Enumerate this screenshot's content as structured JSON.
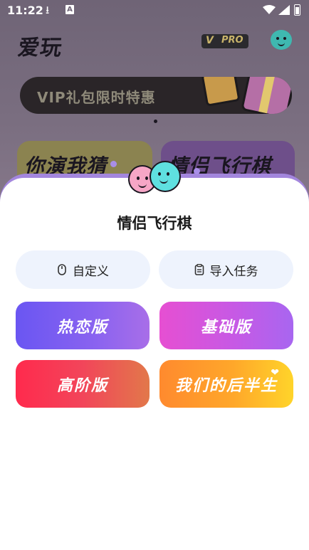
{
  "status_bar": {
    "time": "11:22",
    "download_icon": "download-icon",
    "notification_letter": "A",
    "wifi_icon": "wifi-icon",
    "signal_icon": "signal-icon",
    "battery_icon": "battery-icon"
  },
  "header": {
    "app_title": "爱玩",
    "pro_badge_mark": "V",
    "pro_badge_text": "PRO"
  },
  "banner": {
    "text": "VIP礼包限时特惠"
  },
  "game_cards": [
    {
      "title": "你演我猜"
    },
    {
      "title": "情侣飞行棋"
    }
  ],
  "sheet": {
    "title": "情侣飞行棋",
    "actions": [
      {
        "label": "自定义",
        "icon": "mouse-icon"
      },
      {
        "label": "导入任务",
        "icon": "clipboard-icon"
      }
    ],
    "modes": [
      {
        "label": "热恋版"
      },
      {
        "label": "基础版"
      },
      {
        "label": "高阶版"
      },
      {
        "label": "我们的后半生"
      }
    ]
  },
  "colors": {
    "sheet_rim": "#a386dd",
    "pill_bg": "#eef3fd",
    "mode_hot": "#6a56f2",
    "mode_basic": "#e64fd2",
    "mode_advanced": "#ff2a4d",
    "mode_half": "#ffa72a"
  }
}
